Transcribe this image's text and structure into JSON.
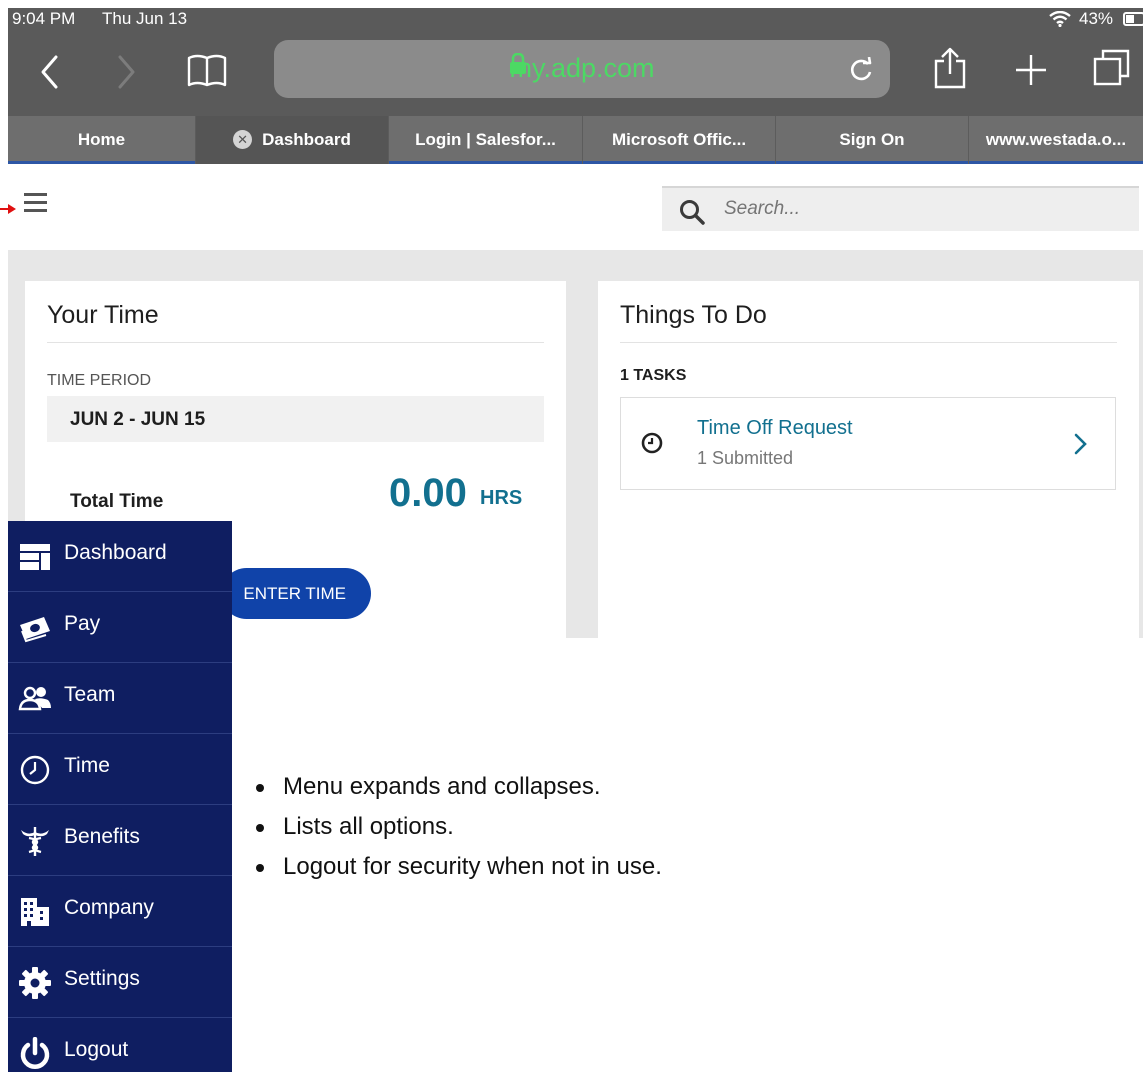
{
  "status_bar": {
    "time": "9:04 PM",
    "date": "Thu Jun 13",
    "battery": "43%"
  },
  "browser": {
    "url": "my.adp.com",
    "tabs": [
      {
        "label": "Home",
        "active": false
      },
      {
        "label": "Dashboard",
        "active": true
      },
      {
        "label": "Login | Salesfor...",
        "active": false
      },
      {
        "label": "Microsoft Offic...",
        "active": false
      },
      {
        "label": "Sign On",
        "active": false
      },
      {
        "label": "www.westada.o...",
        "active": false
      }
    ]
  },
  "search": {
    "placeholder": "Search..."
  },
  "your_time": {
    "title": "Your Time",
    "period_label": "TIME PERIOD",
    "period_value": "JUN 2 - JUN 15",
    "total_label": "Total Time",
    "hours": "0.00",
    "hours_unit": "HRS",
    "enter_button": "ENTER TIME"
  },
  "things_to_do": {
    "title": "Things To Do",
    "tasks_label": "1 TASKS",
    "task": {
      "title": "Time Off Request",
      "status": "1 Submitted"
    }
  },
  "menu": {
    "items": [
      {
        "label": "Dashboard",
        "icon": "dashboard-icon"
      },
      {
        "label": "Pay",
        "icon": "money-icon"
      },
      {
        "label": "Team",
        "icon": "team-icon"
      },
      {
        "label": "Time",
        "icon": "clock-icon"
      },
      {
        "label": "Benefits",
        "icon": "caduceus-icon"
      },
      {
        "label": "Company",
        "icon": "building-icon"
      },
      {
        "label": "Settings",
        "icon": "gear-icon"
      },
      {
        "label": "Logout",
        "icon": "power-icon"
      }
    ]
  },
  "notes": [
    "Menu expands and collapses.",
    "Lists all options.",
    "Logout for security when not in use."
  ],
  "colors": {
    "menu_bg": "#0f1e61",
    "accent_blue": "#1043a9",
    "teal": "#12708f",
    "url_green": "#4cd964",
    "annotation_arrow": "#e01010"
  }
}
